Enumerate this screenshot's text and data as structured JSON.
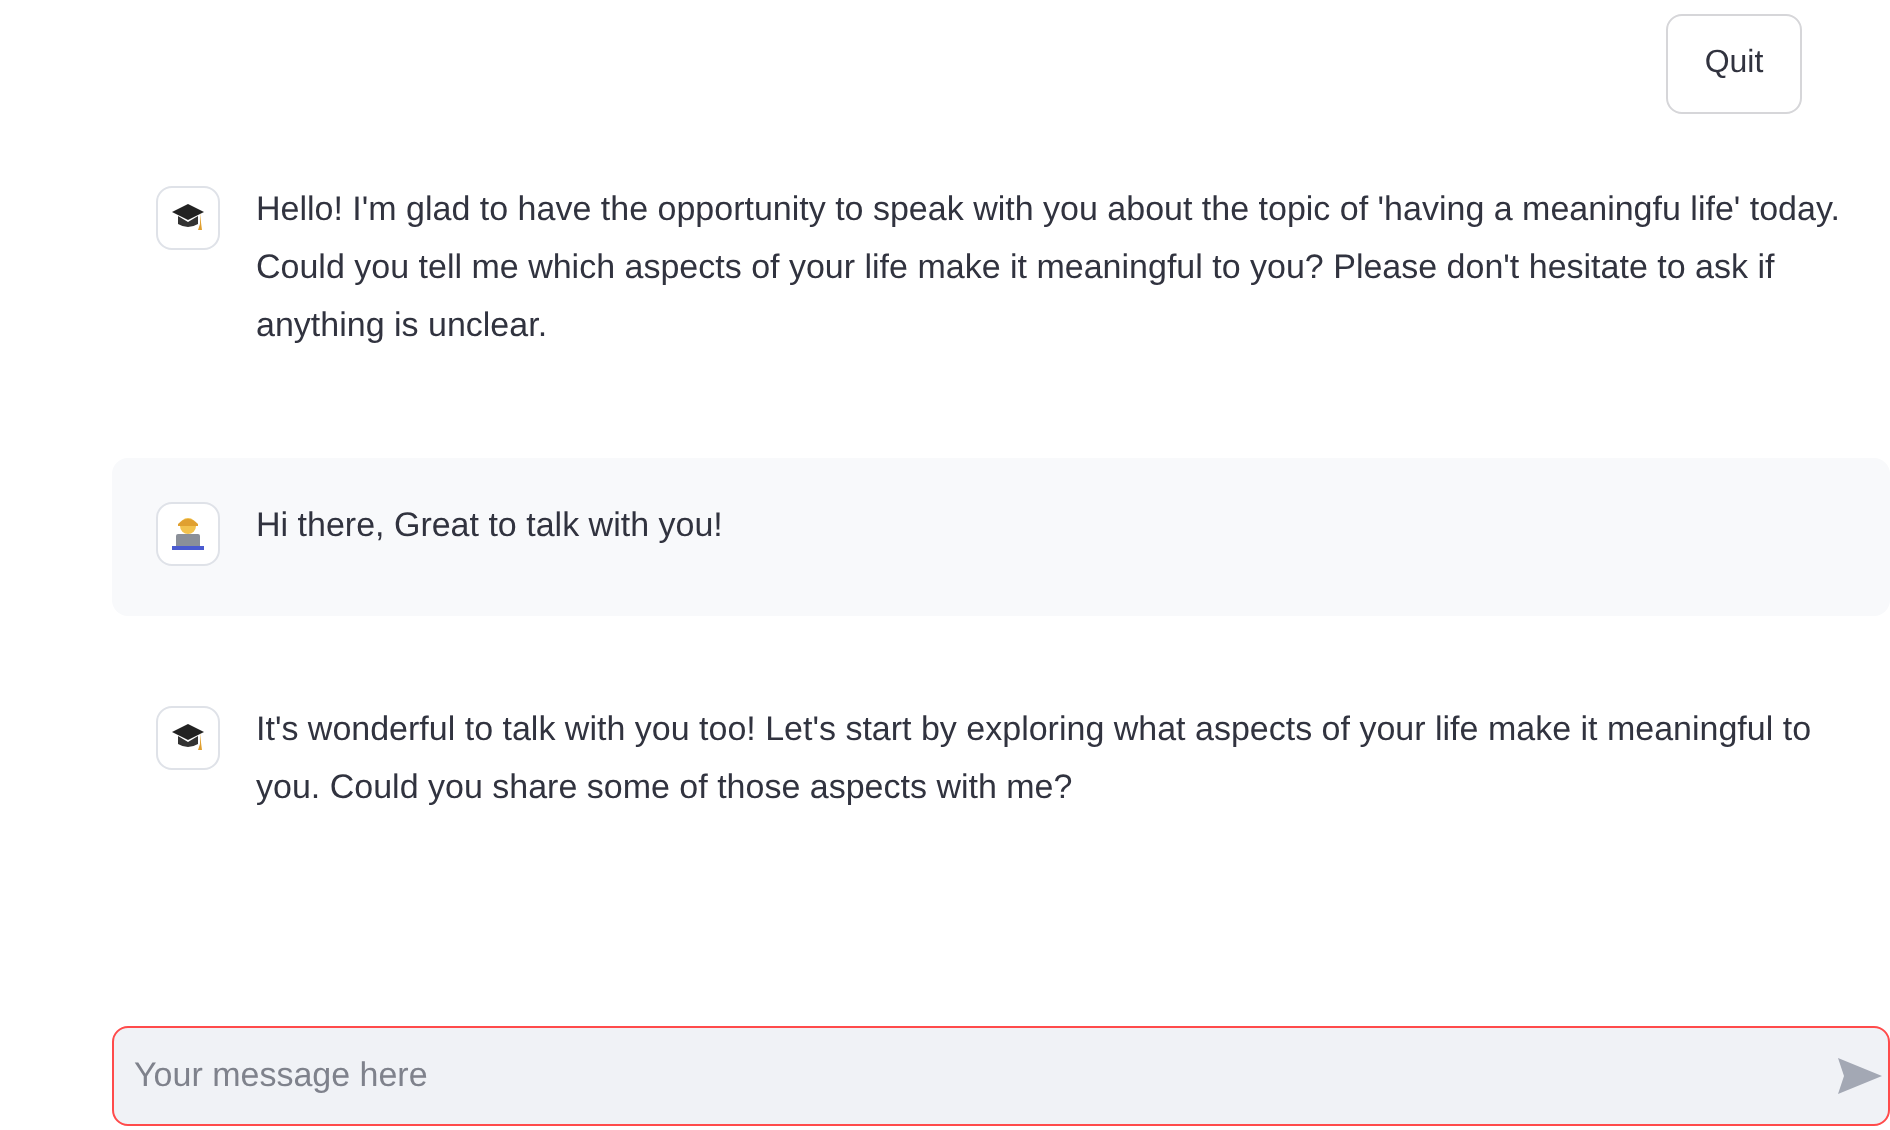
{
  "quit_button": {
    "label": "Quit"
  },
  "messages": [
    {
      "kind": "assistant",
      "text": "Hello! I'm glad to have the opportunity to speak with you about the topic of 'having a meaningfu life' today. Could you tell me which aspects of your life make it meaningful to you? Please don't hesitate to ask if anything is unclear."
    },
    {
      "kind": "user",
      "text": "Hi there, Great to talk with you!"
    },
    {
      "kind": "assistant",
      "text": "It's wonderful to talk with you too! Let's start by exploring what aspects of your life make it meaningful to you. Could you share some of those aspects with me?"
    }
  ],
  "chat_input": {
    "placeholder": "Your message here"
  }
}
